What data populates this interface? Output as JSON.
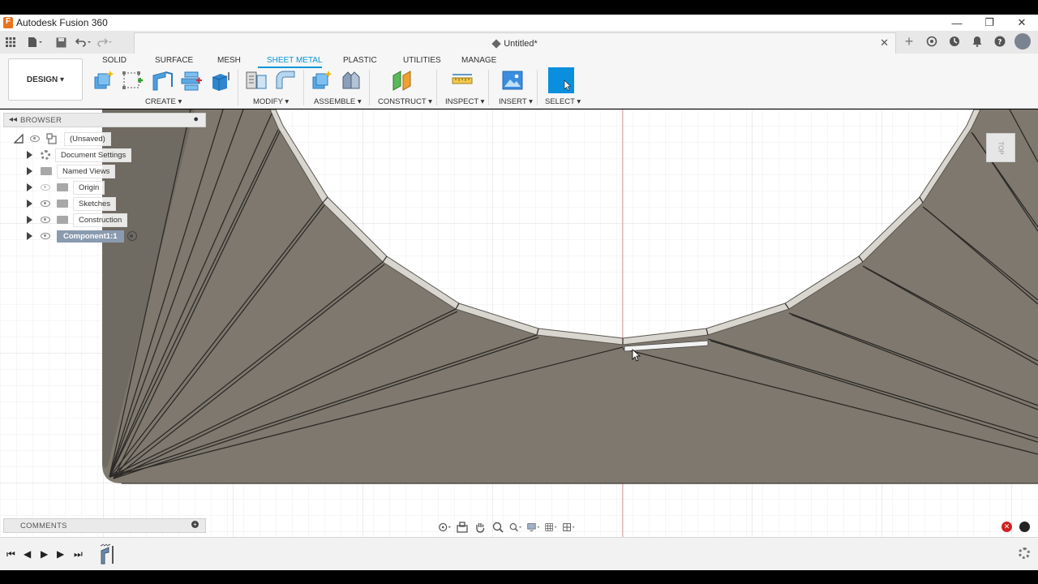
{
  "window": {
    "title": "Autodesk Fusion 360",
    "minimize": "—",
    "maximize": "❐",
    "close": "✕"
  },
  "document_tab": {
    "title": "Untitled*",
    "close": "✕"
  },
  "workspace": {
    "label": "DESIGN ▾"
  },
  "workspace_tabs": [
    {
      "label": "SOLID"
    },
    {
      "label": "SURFACE"
    },
    {
      "label": "MESH"
    },
    {
      "label": "SHEET METAL"
    },
    {
      "label": "PLASTIC"
    },
    {
      "label": "UTILITIES"
    },
    {
      "label": "MANAGE"
    }
  ],
  "tool_groups": {
    "create": "CREATE ▾",
    "modify": "MODIFY ▾",
    "assemble": "ASSEMBLE ▾",
    "construct": "CONSTRUCT ▾",
    "inspect": "INSPECT ▾",
    "insert": "INSERT ▾",
    "select": "SELECT ▾"
  },
  "browser": {
    "title": "BROWSER",
    "root": "(Unsaved)",
    "items": [
      {
        "label": "Document Settings"
      },
      {
        "label": "Named Views"
      },
      {
        "label": "Origin"
      },
      {
        "label": "Sketches"
      },
      {
        "label": "Construction"
      },
      {
        "label": "Component1:1"
      }
    ]
  },
  "viewcube": {
    "label": "TOP"
  },
  "comments": {
    "title": "COMMENTS"
  },
  "colors": {
    "accent": "#0696d7",
    "part": "#857f74",
    "edge": "#d6d3cd"
  }
}
